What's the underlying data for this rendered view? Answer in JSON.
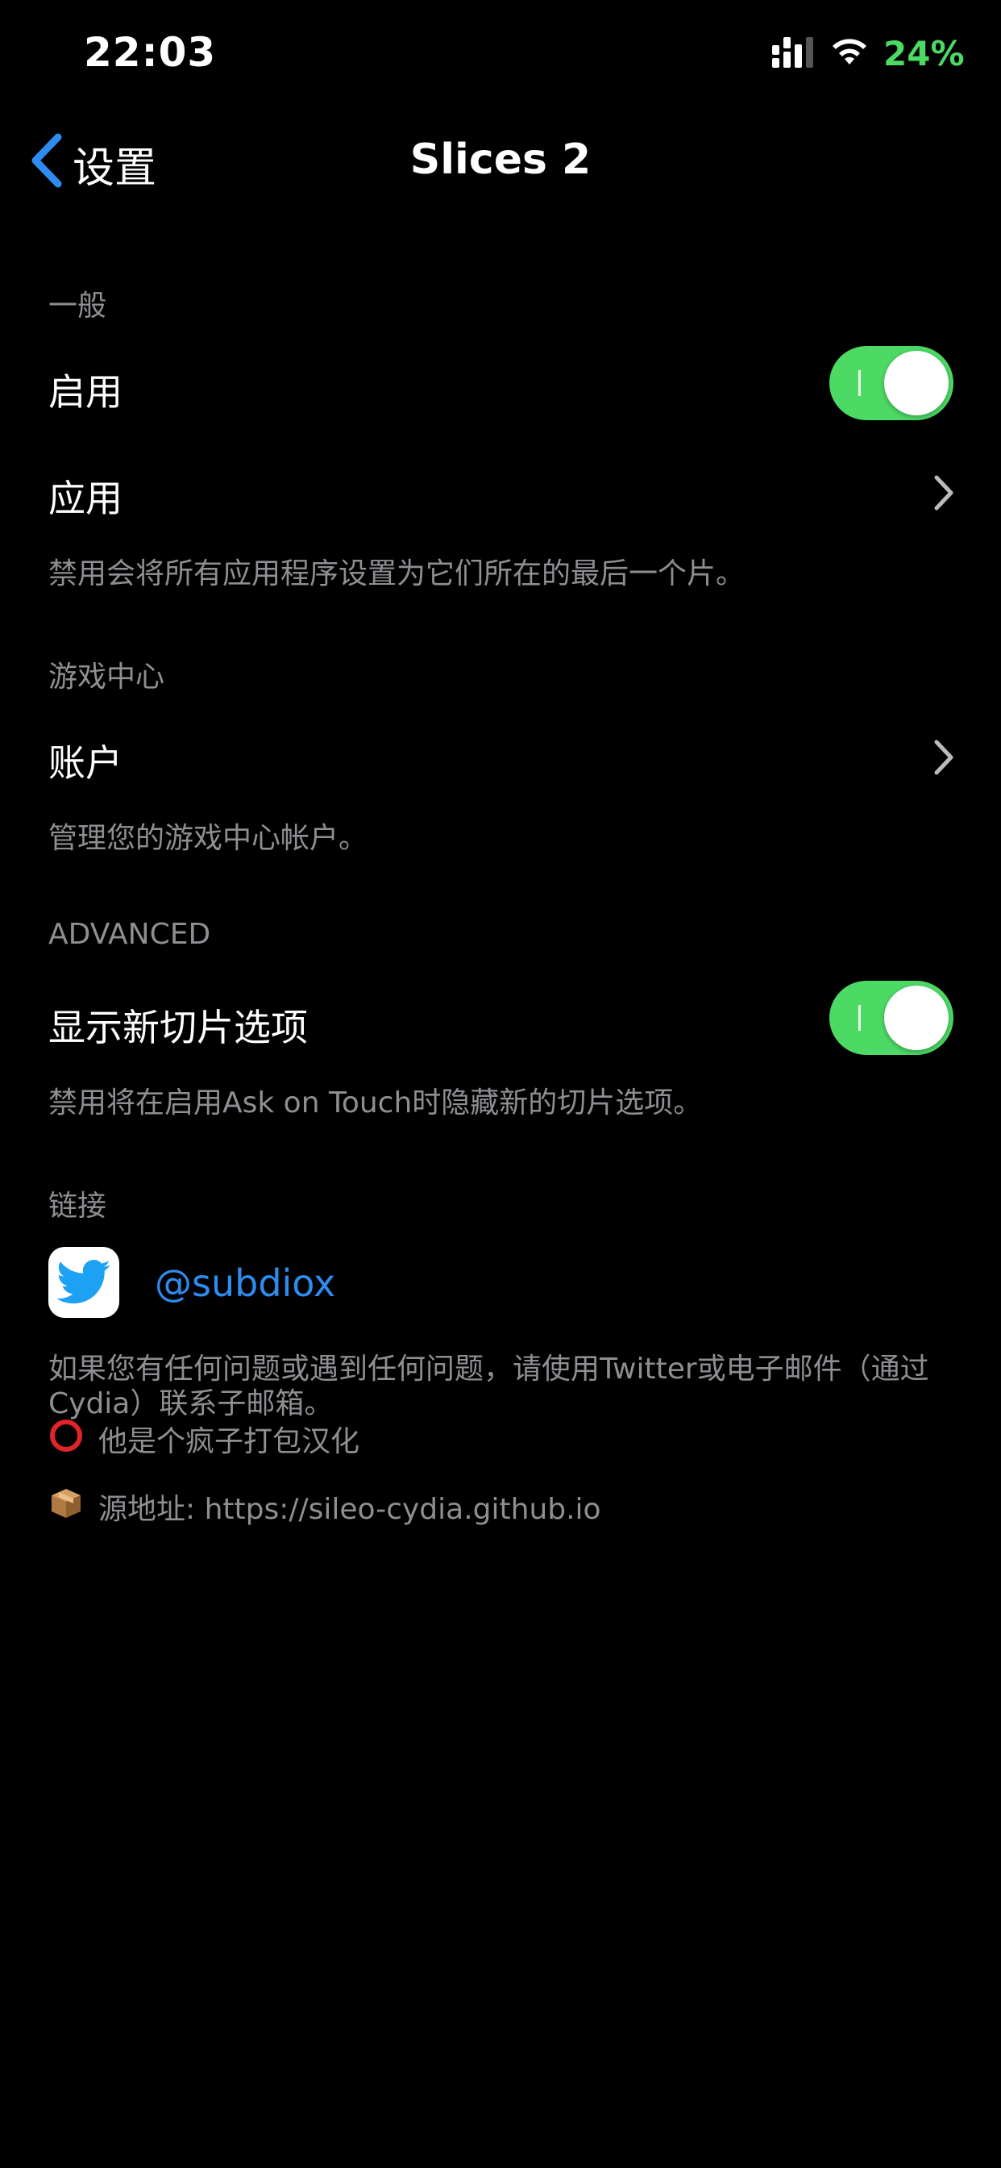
{
  "status_bar": {
    "time": "22:03",
    "battery": "24%"
  },
  "nav": {
    "back_label": "设置",
    "title": "Slices 2"
  },
  "sections": {
    "general": {
      "header": "一般",
      "enable_label": "启用",
      "enable_on": true,
      "apps_label": "应用",
      "footer": "禁用会将所有应用程序设置为它们所在的最后一个片。"
    },
    "game_center": {
      "header": "游戏中心",
      "account_label": "账户",
      "footer": "管理您的游戏中心帐户。"
    },
    "advanced": {
      "header": "ADVANCED",
      "show_new_label": "显示新切片选项",
      "show_new_on": true,
      "footer": "禁用将在启用Ask on Touch时隐藏新的切片选项。"
    },
    "links": {
      "header": "链接",
      "twitter_handle": "@subdiox",
      "footer_line1": "如果您有任何问题或遇到任何问题，请使用Twitter或电子邮件（通过Cydia）联系子邮箱。",
      "footer_line2": "他是个疯子打包汉化",
      "footer_line3": "源地址: https://sileo-cydia.github.io"
    }
  },
  "colors": {
    "accent": "#2e8cf0",
    "toggle_on": "#4cd964",
    "battery": "#4cd964",
    "secondary_text": "#8e8e93"
  },
  "icons": [
    "signal-icon",
    "wifi-icon",
    "back-chevron-icon",
    "toggle-switch",
    "chevron-right-icon",
    "twitter-bird-icon",
    "red-circle-icon",
    "package-icon"
  ]
}
